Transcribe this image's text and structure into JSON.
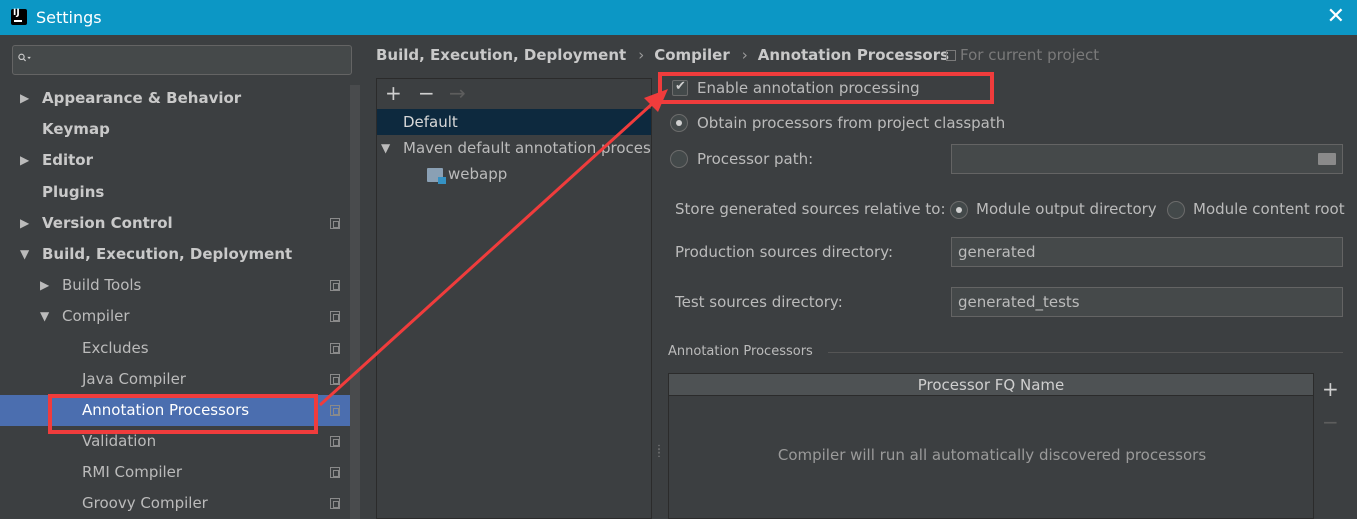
{
  "window": {
    "title": "Settings",
    "close_glyph": "✕"
  },
  "sidebar": {
    "search_placeholder": "",
    "items": [
      {
        "label": "Appearance & Behavior",
        "arrow": "▶",
        "bold": true
      },
      {
        "label": "Keymap",
        "arrow": "",
        "bold": true
      },
      {
        "label": "Editor",
        "arrow": "▶",
        "bold": true
      },
      {
        "label": "Plugins",
        "arrow": "",
        "bold": true
      },
      {
        "label": "Version Control",
        "arrow": "▶",
        "bold": true
      },
      {
        "label": "Build, Execution, Deployment",
        "arrow": "▼",
        "bold": true
      },
      {
        "label": "Build Tools",
        "arrow": "▶",
        "bold": false
      },
      {
        "label": "Compiler",
        "arrow": "▼",
        "bold": false
      },
      {
        "label": "Excludes",
        "arrow": "",
        "bold": false
      },
      {
        "label": "Java Compiler",
        "arrow": "",
        "bold": false
      },
      {
        "label": "Annotation Processors",
        "arrow": "",
        "bold": false,
        "selected": true
      },
      {
        "label": "Validation",
        "arrow": "",
        "bold": false
      },
      {
        "label": "RMI Compiler",
        "arrow": "",
        "bold": false
      },
      {
        "label": "Groovy Compiler",
        "arrow": "",
        "bold": false
      }
    ]
  },
  "breadcrumb": {
    "parts": [
      "Build, Execution, Deployment",
      "Compiler",
      "Annotation Processors"
    ],
    "separator": "›",
    "scope": "For current project"
  },
  "profiles": {
    "add": "+",
    "remove": "−",
    "move": "→",
    "default_label": "Default",
    "maven_label": "Maven default annotation processors profile",
    "maven_arrow": "▼",
    "module_label": "webapp"
  },
  "options": {
    "enable_label": "Enable annotation processing",
    "enable_checked": true,
    "obtain_label": "Obtain processors from project classpath",
    "path_label": "Processor path:",
    "processor_path_value": "",
    "store_label": "Store generated sources relative to:",
    "module_output_label": "Module output directory",
    "module_content_label": "Module content root",
    "production_label": "Production sources directory:",
    "production_value": "generated",
    "test_label": "Test sources directory:",
    "test_value": "generated_tests"
  },
  "processors": {
    "group_title": "Annotation Processors",
    "column": "Processor FQ Name",
    "empty_text": "Compiler will run all automatically discovered processors",
    "add": "+",
    "remove": "−"
  },
  "colors": {
    "title_bar": "#0c97c5",
    "selection": "#4b6eaf",
    "annotation_red": "#f03c3c"
  }
}
